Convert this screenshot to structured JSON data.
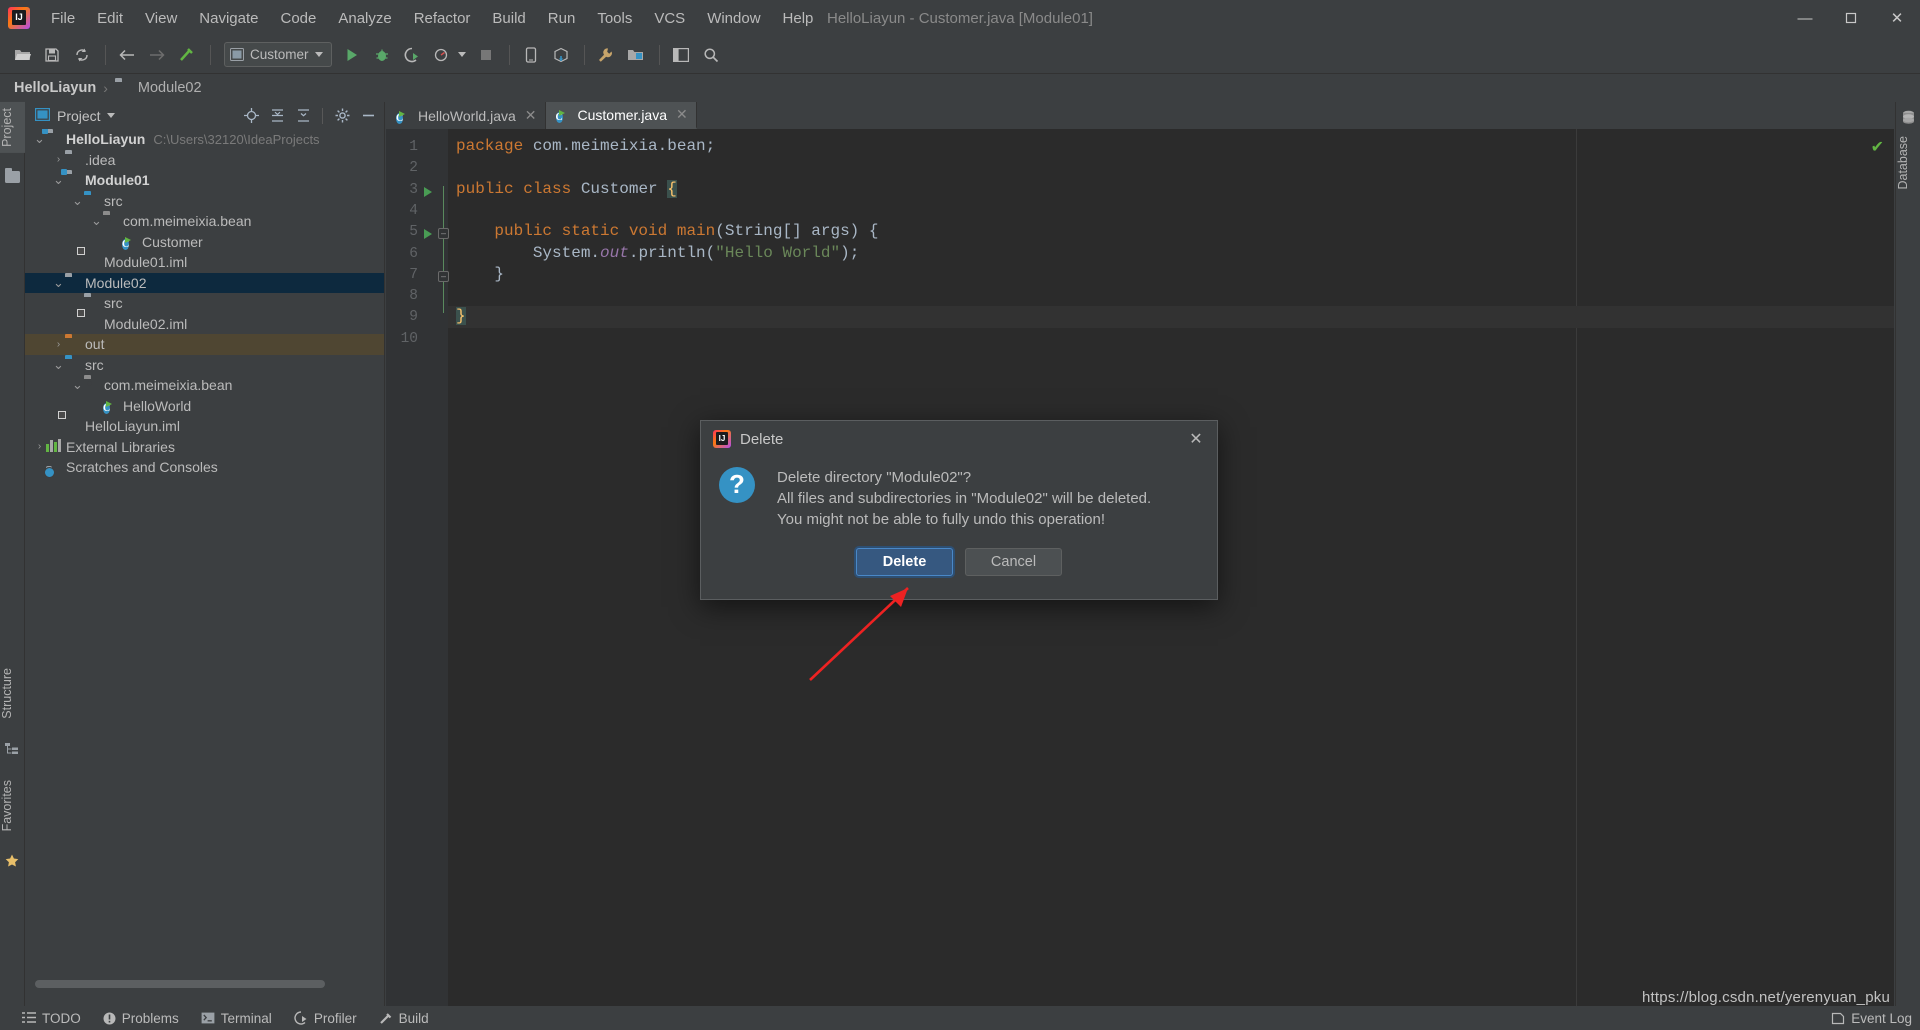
{
  "window": {
    "title": "HelloLiayun - Customer.java [Module01]",
    "logo_icon": "intellij-idea-logo",
    "minimize_label": "—",
    "maximize_label": "❐",
    "close_label": "✕"
  },
  "menubar": {
    "items": [
      {
        "label": "File",
        "mnemonic": "F"
      },
      {
        "label": "Edit",
        "mnemonic": "E"
      },
      {
        "label": "View",
        "mnemonic": "V"
      },
      {
        "label": "Navigate",
        "mnemonic": "N"
      },
      {
        "label": "Code",
        "mnemonic": "C"
      },
      {
        "label": "Analyze",
        "mnemonic": "z"
      },
      {
        "label": "Refactor",
        "mnemonic": "R"
      },
      {
        "label": "Build",
        "mnemonic": "B"
      },
      {
        "label": "Run",
        "mnemonic": "u"
      },
      {
        "label": "Tools",
        "mnemonic": "T"
      },
      {
        "label": "VCS",
        "mnemonic": ""
      },
      {
        "label": "Window",
        "mnemonic": "W"
      },
      {
        "label": "Help",
        "mnemonic": "H"
      }
    ]
  },
  "toolbar": {
    "run_config": "Customer",
    "icons": [
      "open-folder-icon",
      "save-icon",
      "sync-icon",
      "back-arrow-icon",
      "forward-arrow-icon",
      "build-hammer-icon",
      "run-icon",
      "debug-icon",
      "run-coverage-icon",
      "profile-icon",
      "stop-icon",
      "device-manager-icon",
      "sdk-manager-icon",
      "settings-wrench-icon",
      "project-structure-icon",
      "layout-icon",
      "search-icon"
    ]
  },
  "breadcrumb": {
    "root": "HelloLiayun",
    "separator": "›",
    "node": "Module02",
    "node_icon": "folder-icon"
  },
  "left_strip": {
    "tabs": [
      {
        "label": "Project",
        "icon": "project-icon",
        "active": true
      },
      {
        "label": "Structure",
        "icon": "structure-icon",
        "active": false
      },
      {
        "label": "Favorites",
        "icon": "favorites-star-icon",
        "active": false
      }
    ]
  },
  "right_strip": {
    "tabs": [
      {
        "label": "Database",
        "icon": "database-icon",
        "active": false
      }
    ]
  },
  "project_panel": {
    "title": "Project",
    "title_icon": "project-view-icon",
    "dropdown_icon": "chevron-down-icon",
    "actions": [
      "locate-target-icon",
      "expand-all-icon",
      "collapse-all-icon",
      "settings-gear-icon",
      "hide-minus-icon"
    ],
    "tree": [
      {
        "label": "HelloLiayun",
        "path": "C:\\Users\\32120\\IdeaProjects",
        "depth": 0,
        "arrow": "expanded",
        "icon": "module-folder-icon",
        "bold": true,
        "state": "normal"
      },
      {
        "label": ".idea",
        "path": "",
        "depth": 1,
        "arrow": "collapsed",
        "icon": "folder-grey-icon",
        "bold": false,
        "state": "normal"
      },
      {
        "label": "Module01",
        "path": "",
        "depth": 1,
        "arrow": "expanded",
        "icon": "module-folder-icon",
        "bold": true,
        "state": "normal"
      },
      {
        "label": "src",
        "path": "",
        "depth": 2,
        "arrow": "expanded",
        "icon": "source-folder-icon",
        "bold": false,
        "state": "normal"
      },
      {
        "label": "com.meimeixia.bean",
        "path": "",
        "depth": 3,
        "arrow": "expanded",
        "icon": "package-icon",
        "bold": false,
        "state": "normal"
      },
      {
        "label": "Customer",
        "path": "",
        "depth": 4,
        "arrow": "none",
        "icon": "java-class-icon",
        "bold": false,
        "state": "normal"
      },
      {
        "label": "Module01.iml",
        "path": "",
        "depth": 2,
        "arrow": "none",
        "icon": "iml-file-icon",
        "bold": false,
        "state": "normal"
      },
      {
        "label": "Module02",
        "path": "",
        "depth": 1,
        "arrow": "expanded",
        "icon": "folder-grey-icon",
        "bold": false,
        "state": "selected"
      },
      {
        "label": "src",
        "path": "",
        "depth": 2,
        "arrow": "none",
        "icon": "folder-grey-icon",
        "bold": false,
        "state": "normal"
      },
      {
        "label": "Module02.iml",
        "path": "",
        "depth": 2,
        "arrow": "none",
        "icon": "iml-file-icon",
        "bold": false,
        "state": "normal"
      },
      {
        "label": "out",
        "path": "",
        "depth": 1,
        "arrow": "collapsed",
        "icon": "excluded-folder-icon",
        "bold": false,
        "state": "excluded"
      },
      {
        "label": "src",
        "path": "",
        "depth": 1,
        "arrow": "expanded",
        "icon": "source-folder-icon",
        "bold": false,
        "state": "normal"
      },
      {
        "label": "com.meimeixia.bean",
        "path": "",
        "depth": 2,
        "arrow": "expanded",
        "icon": "package-icon",
        "bold": false,
        "state": "normal"
      },
      {
        "label": "HelloWorld",
        "path": "",
        "depth": 3,
        "arrow": "none",
        "icon": "java-class-icon",
        "bold": false,
        "state": "normal"
      },
      {
        "label": "HelloLiayun.iml",
        "path": "",
        "depth": 1,
        "arrow": "none",
        "icon": "iml-file-icon",
        "bold": false,
        "state": "normal"
      },
      {
        "label": "External Libraries",
        "path": "",
        "depth": 0,
        "arrow": "collapsed",
        "icon": "libraries-icon",
        "bold": false,
        "state": "normal"
      },
      {
        "label": "Scratches and Consoles",
        "path": "",
        "depth": 0,
        "arrow": "none",
        "icon": "scratches-icon",
        "bold": false,
        "state": "normal"
      }
    ]
  },
  "editor": {
    "tabs": [
      {
        "label": "HelloWorld.java",
        "icon": "java-class-icon",
        "active": false,
        "close": "✕"
      },
      {
        "label": "Customer.java",
        "icon": "java-class-icon",
        "active": true,
        "close": "✕"
      }
    ],
    "inspection_status": "✔",
    "line_numbers": [
      "1",
      "2",
      "3",
      "4",
      "5",
      "6",
      "7",
      "8",
      "9",
      "10"
    ],
    "lines": [
      {
        "n": 1,
        "segments": [
          {
            "t": "package",
            "c": "kw"
          },
          {
            "t": " com.meimeixia.bean;",
            "c": "plain"
          }
        ]
      },
      {
        "n": 2,
        "segments": []
      },
      {
        "n": 3,
        "segments": [
          {
            "t": "public class",
            "c": "kw"
          },
          {
            "t": " ",
            "c": "plain"
          },
          {
            "t": "Customer",
            "c": "cname"
          },
          {
            "t": " ",
            "c": "plain"
          },
          {
            "t": "{",
            "c": "brace-hl"
          }
        ]
      },
      {
        "n": 4,
        "segments": []
      },
      {
        "n": 5,
        "segments": [
          {
            "t": "    ",
            "c": "plain"
          },
          {
            "t": "public static void",
            "c": "kw"
          },
          {
            "t": " ",
            "c": "plain"
          },
          {
            "t": "main",
            "c": "kw"
          },
          {
            "t": "(",
            "c": "plain"
          },
          {
            "t": "String",
            "c": "typ"
          },
          {
            "t": "[] args) {",
            "c": "plain"
          }
        ]
      },
      {
        "n": 6,
        "segments": [
          {
            "t": "        System.",
            "c": "plain"
          },
          {
            "t": "out",
            "c": "fld"
          },
          {
            "t": ".println(",
            "c": "plain"
          },
          {
            "t": "\"Hello World\"",
            "c": "str"
          },
          {
            "t": ");",
            "c": "plain"
          }
        ]
      },
      {
        "n": 7,
        "segments": [
          {
            "t": "    }",
            "c": "plain"
          }
        ]
      },
      {
        "n": 8,
        "segments": []
      },
      {
        "n": 9,
        "segments": [
          {
            "t": "}",
            "c": "brace-hl"
          }
        ]
      },
      {
        "n": 10,
        "segments": []
      }
    ],
    "run_markers": [
      3,
      5
    ],
    "caret_line": 9
  },
  "dialog": {
    "title": "Delete",
    "title_icon": "intellij-idea-logo",
    "close_label": "✕",
    "question_icon": "question-mark-icon",
    "message_lines": [
      "Delete directory \"Module02\"?",
      "All files and subdirectories in \"Module02\" will be deleted.",
      "You might not be able to fully undo this operation!"
    ],
    "buttons": [
      {
        "label": "Delete",
        "style": "primary"
      },
      {
        "label": "Cancel",
        "style": "normal"
      }
    ]
  },
  "statusbar": {
    "items": [
      {
        "label": "TODO",
        "icon": "todo-list-icon"
      },
      {
        "label": "Problems",
        "icon": "problems-warning-icon"
      },
      {
        "label": "Terminal",
        "icon": "terminal-icon"
      },
      {
        "label": "Profiler",
        "icon": "profiler-icon"
      },
      {
        "label": "Build",
        "icon": "build-hammer-icon"
      }
    ],
    "event_log": "Event Log",
    "event_log_icon": "event-log-icon"
  },
  "watermark": "https://blog.csdn.net/yerenyuan_pku",
  "colors": {
    "accent_blue": "#3592c4",
    "selection_blue": "#0d293e",
    "excluded_olive": "#4f4632",
    "keyword_orange": "#cc7832",
    "string_green": "#6a8759",
    "field_purple": "#9876aa",
    "editor_bg": "#2b2b2b",
    "panel_bg": "#3c3f41",
    "annotation_red": "#ee2222"
  }
}
